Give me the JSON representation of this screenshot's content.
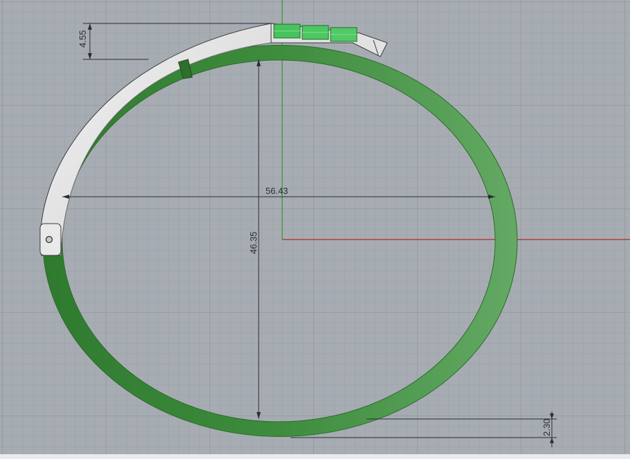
{
  "viewport": {
    "name": "top-view",
    "background": "#a7acb3",
    "grid_minor_color": "#9aa0a7",
    "grid_major_color": "#8d9399",
    "x_axis_color": "#b0403a",
    "y_axis_color": "#3f9c3f"
  },
  "model": {
    "band_color": "#3c8a3c",
    "band_highlight": "#5fae5f",
    "clasp_color": "#e4e4e4",
    "stone_color": "#3fbf55"
  },
  "dimensions": {
    "width": "56.43",
    "height": "46.35",
    "offset_top": "4.55",
    "thickness": "2.30"
  }
}
